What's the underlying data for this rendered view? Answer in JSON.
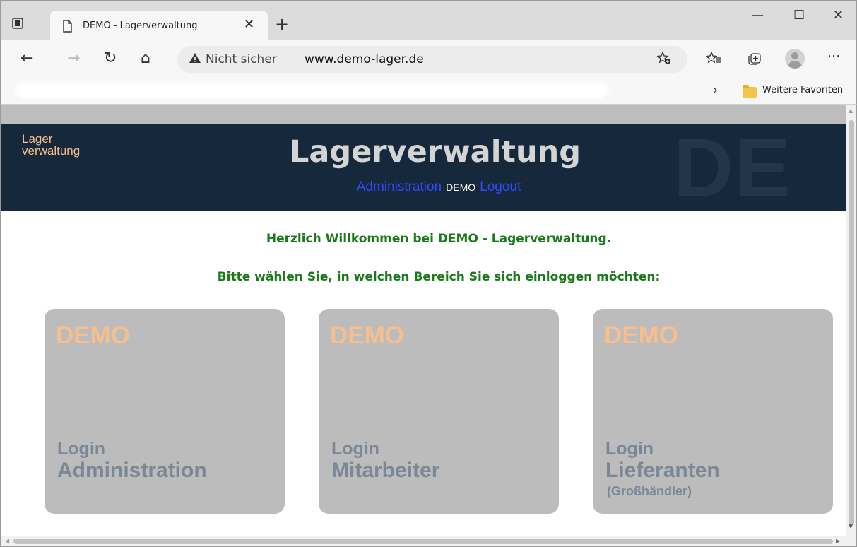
{
  "browser": {
    "tab_title": "DEMO - Lagerverwaltung",
    "close_glyph": "✕",
    "newtab_glyph": "+",
    "window": {
      "minimize": "—",
      "maximize": "☐",
      "close": "✕"
    },
    "nav": {
      "back": "←",
      "forward": "→",
      "reload": "↻",
      "home": "⌂"
    },
    "security_label": "Nicht sicher",
    "url": "www.demo-lager.de",
    "more_glyph": "···",
    "favorites_chevron": "›",
    "favorites_folder": "Weitere Favoriten"
  },
  "header": {
    "brand_line1": "Lager",
    "brand_line2": "verwaltung",
    "title": "Lagerverwaltung",
    "watermark": "DE",
    "nav": {
      "administration": "Administration",
      "demo": "DEMO",
      "logout": "Logout"
    }
  },
  "main": {
    "welcome": "Herzlich Willkommen bei DEMO - Lagerverwaltung.",
    "choose": "Bitte wählen Sie, in welchen Bereich Sie sich einloggen möchten:",
    "cards": [
      {
        "badge": "DEMO",
        "line1": "Login",
        "line2": "Administration",
        "line3": ""
      },
      {
        "badge": "DEMO",
        "line1": "Login",
        "line2": "Mitarbeiter",
        "line3": ""
      },
      {
        "badge": "DEMO",
        "line1": "Login",
        "line2": "Lieferanten",
        "line3": "(Großhändler)"
      }
    ]
  },
  "colors": {
    "banner_bg": "#16283b",
    "heading": "#d4d4d4",
    "brand": "#f5be8a",
    "link": "#3349ff",
    "welcome_text": "#1a7a1a",
    "card_bg": "#bcbcbc",
    "card_badge": "#f7bf8d",
    "card_text": "#7b8796"
  }
}
